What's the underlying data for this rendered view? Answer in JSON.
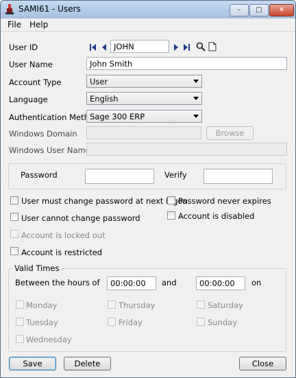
{
  "window": {
    "title": "SAMI61 - Users"
  },
  "titlebar_buttons": {
    "minimize": "–",
    "maximize": "□",
    "close": "✕"
  },
  "menu": [
    "File",
    "Help"
  ],
  "labels": {
    "user_id": "User ID",
    "user_name": "User Name",
    "account_type": "Account Type",
    "language": "Language",
    "auth_method": "Authentication Method",
    "windows_domain": "Windows Domain",
    "windows_user_name": "Windows User Name",
    "password": "Password",
    "verify": "Verify",
    "valid_times": "Valid Times",
    "between_hours": "Between the hours of",
    "and": "and",
    "on": "on"
  },
  "fields": {
    "user_id": "JOHN",
    "user_name": "John Smith",
    "account_type": "User",
    "language": "English",
    "auth_method": "Sage 300 ERP",
    "windows_domain": "",
    "windows_user_name": "",
    "password": "",
    "verify": "",
    "time_from": "00:00:00",
    "time_to": "00:00:00"
  },
  "browse_label": "Browse",
  "options": {
    "must_change_password": {
      "label": "User must change password at next logon",
      "checked": false,
      "enabled": true
    },
    "never_expires": {
      "label": "Password never expires",
      "checked": false,
      "enabled": true
    },
    "cannot_change": {
      "label": "User cannot change password",
      "checked": false,
      "enabled": true
    },
    "disabled": {
      "label": "Account is disabled",
      "checked": false,
      "enabled": true
    },
    "locked_out": {
      "label": "Account is locked out",
      "checked": false,
      "enabled": false
    },
    "restricted": {
      "label": "Account is restricted",
      "checked": false,
      "enabled": true
    }
  },
  "days": {
    "monday": "Monday",
    "thursday": "Thursday",
    "saturday": "Saturday",
    "tuesday": "Tuesday",
    "friday": "Friday",
    "sunday": "Sunday",
    "wednesday": "Wednesday"
  },
  "buttons": {
    "save": "Save",
    "delete": "Delete",
    "close": "Close"
  },
  "icons": {
    "first": "first-record-icon",
    "previous": "previous-record-icon",
    "next": "next-record-icon",
    "last": "last-record-icon",
    "finder": "search-icon",
    "new": "new-document-icon"
  }
}
